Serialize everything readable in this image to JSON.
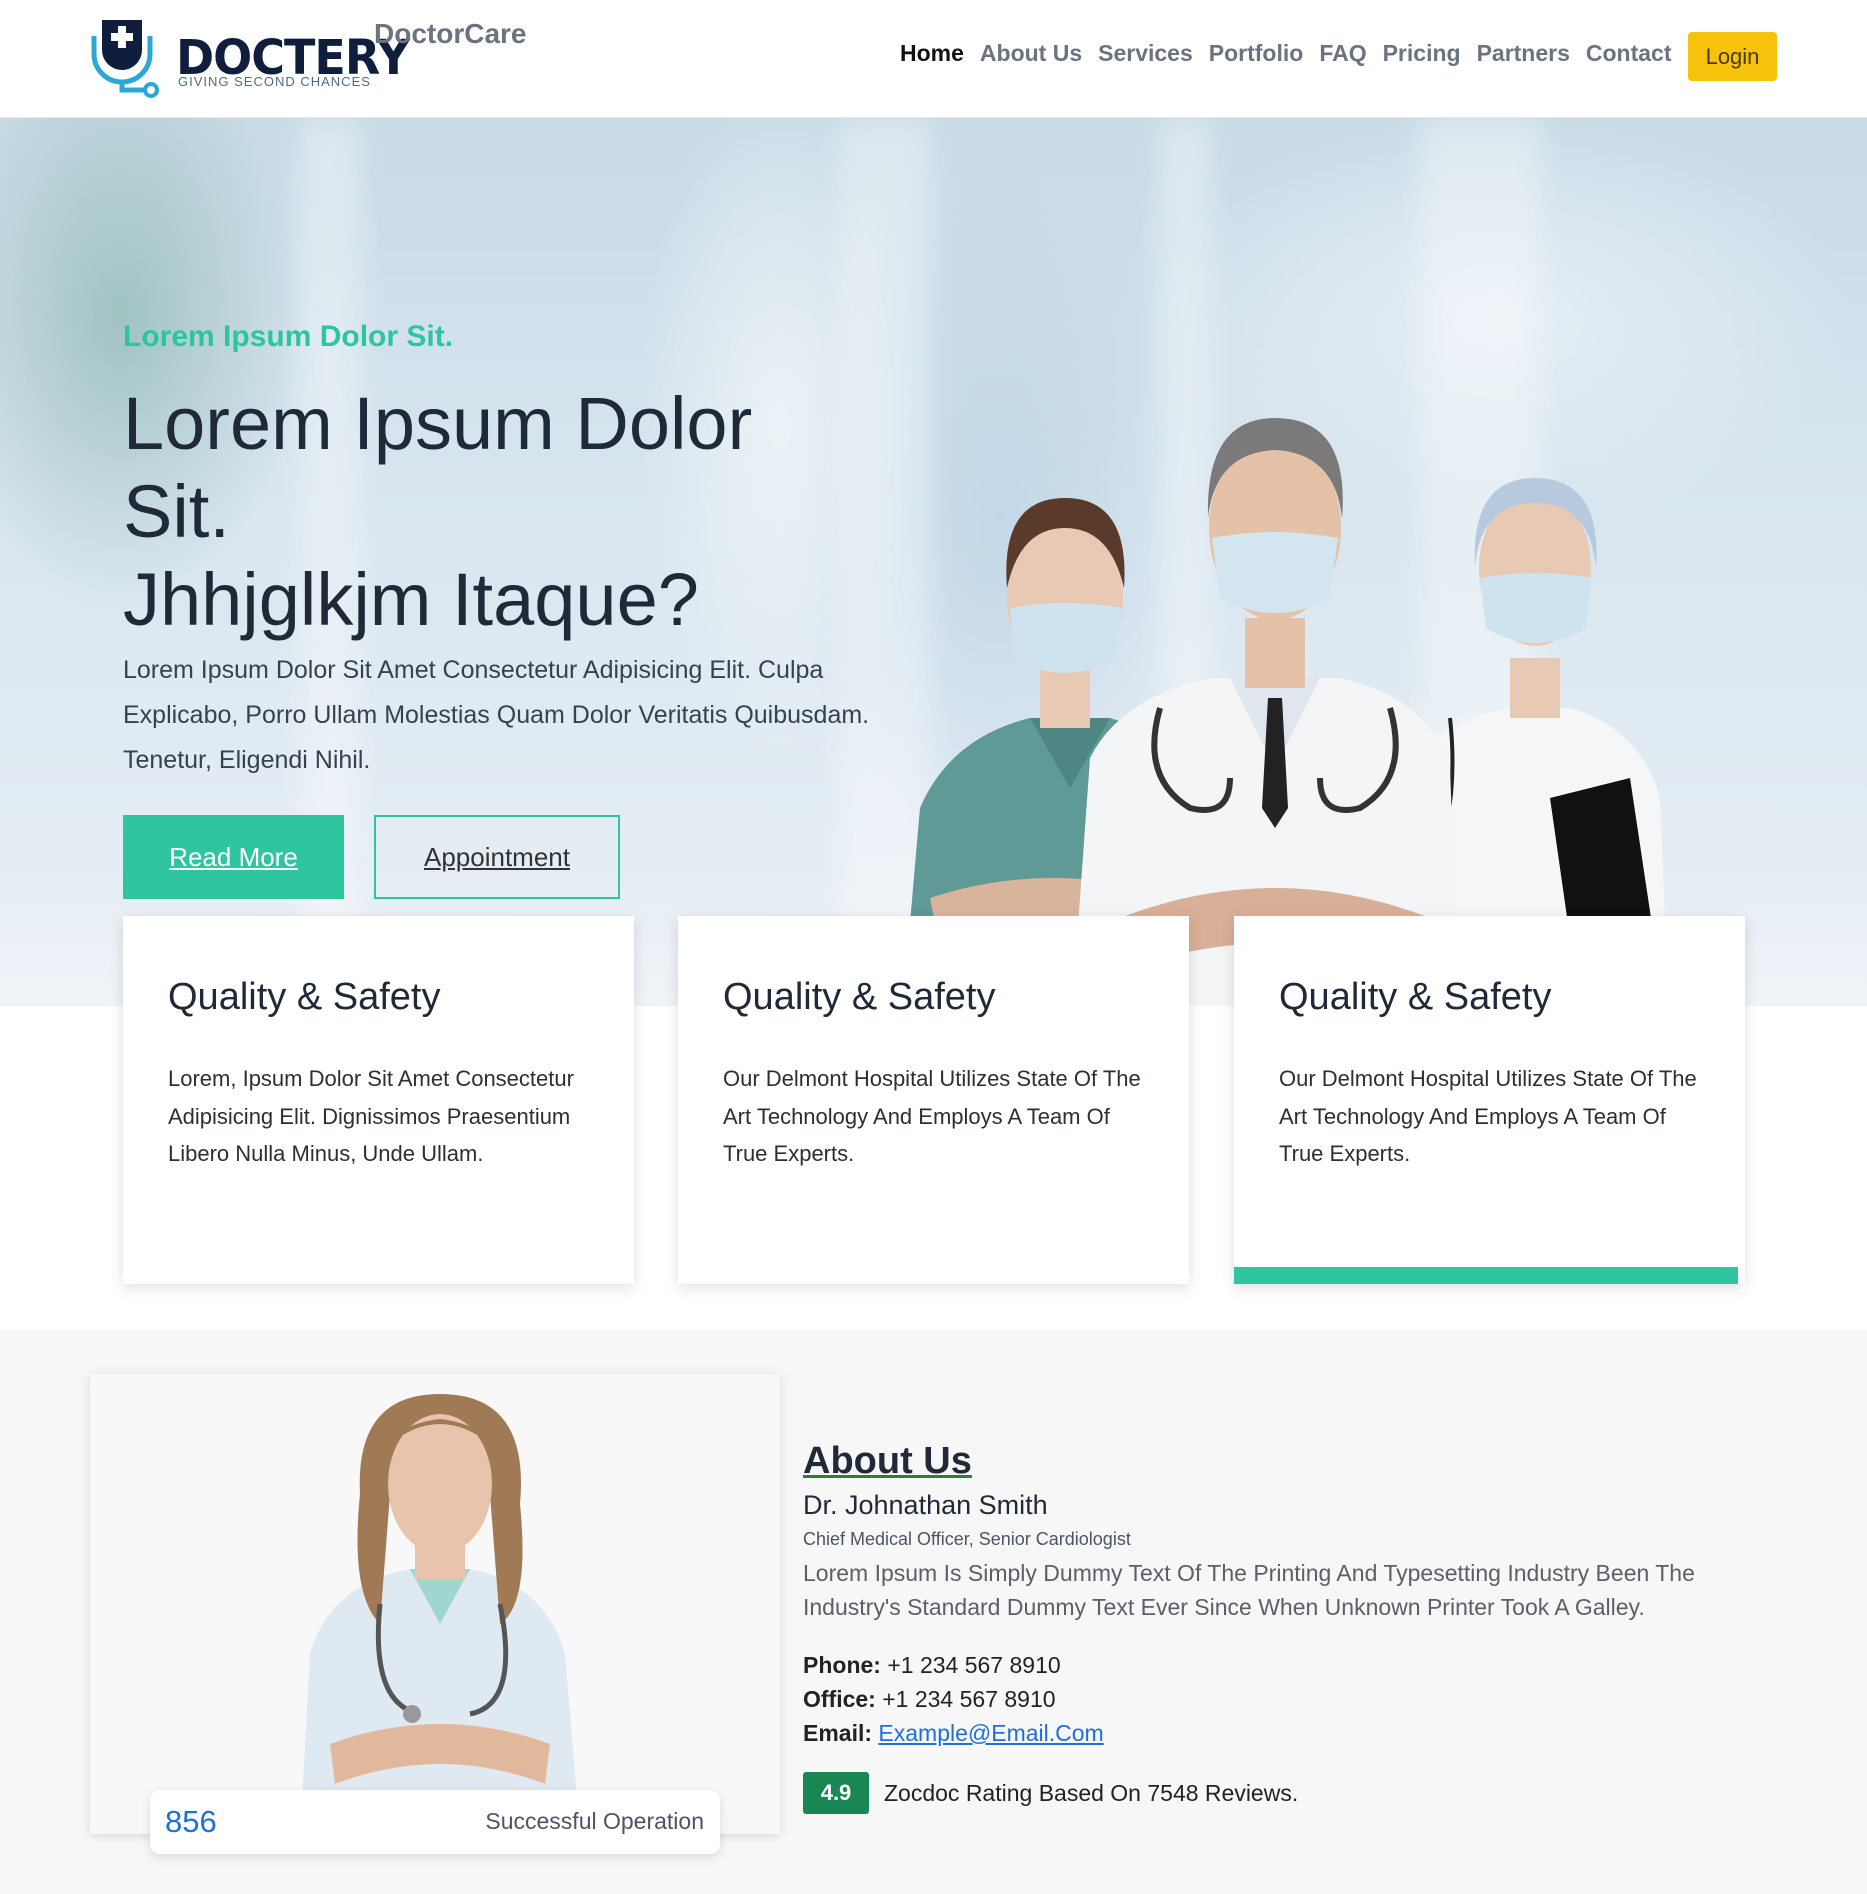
{
  "header": {
    "logo_word": "DOCTERY",
    "logo_tagline": "GIVING SECOND CHANCES",
    "brand_name": "DoctorCare",
    "nav": [
      "Home",
      "About Us",
      "Services",
      "Portfolio",
      "FAQ",
      "Pricing",
      "Partners",
      "Contact"
    ],
    "active_nav": "Home",
    "login_label": "Login"
  },
  "hero": {
    "kicker": "Lorem Ipsum Dolor Sit.",
    "title_line1": "Lorem Ipsum Dolor",
    "title_line2": "Sit.",
    "title_line3": "Jhhjglkjm Itaque?",
    "description": "Lorem Ipsum Dolor Sit Amet Consectetur Adipisicing Elit. Culpa Explicabo, Porro Ullam Molestias Quam Dolor Veritatis Quibusdam. Tenetur, Eligendi Nihil.",
    "read_more_label": "Read More",
    "appointment_label": "Appointment"
  },
  "cards": [
    {
      "title": "Quality & Safety",
      "text": "Lorem, Ipsum Dolor Sit Amet Consectetur Adipisicing Elit. Dignissimos Praesentium Libero Nulla Minus, Unde Ullam."
    },
    {
      "title": "Quality & Safety",
      "text": "Our Delmont Hospital Utilizes State Of The Art Technology And Employs A Team Of True Experts."
    },
    {
      "title": "Quality & Safety",
      "text": "Our Delmont Hospital Utilizes State Of The Art Technology And Employs A Team Of True Experts."
    }
  ],
  "about": {
    "heading": "About Us",
    "doctor_name": "Dr. Johnathan Smith",
    "doctor_role": "Chief Medical Officer, Senior Cardiologist",
    "bio": "Lorem Ipsum Is Simply Dummy Text Of The Printing And Typesetting Industry Been The Industry's Standard Dummy Text Ever Since When Unknown Printer Took A Galley.",
    "phone_label": "Phone:",
    "phone": "+1 234 567 8910",
    "office_label": "Office:",
    "office": "+1 234 567 8910",
    "email_label": "Email:",
    "email": "Example@Email.Com",
    "rating": "4.9",
    "rating_text": "Zocdoc Rating Based On 7548 Reviews.",
    "stat_number": "856",
    "stat_label": "Successful Operation"
  },
  "colors": {
    "accent": "#2ec5a0",
    "login": "#f7c20b",
    "rating": "#198754",
    "link": "#1f6fd6"
  }
}
